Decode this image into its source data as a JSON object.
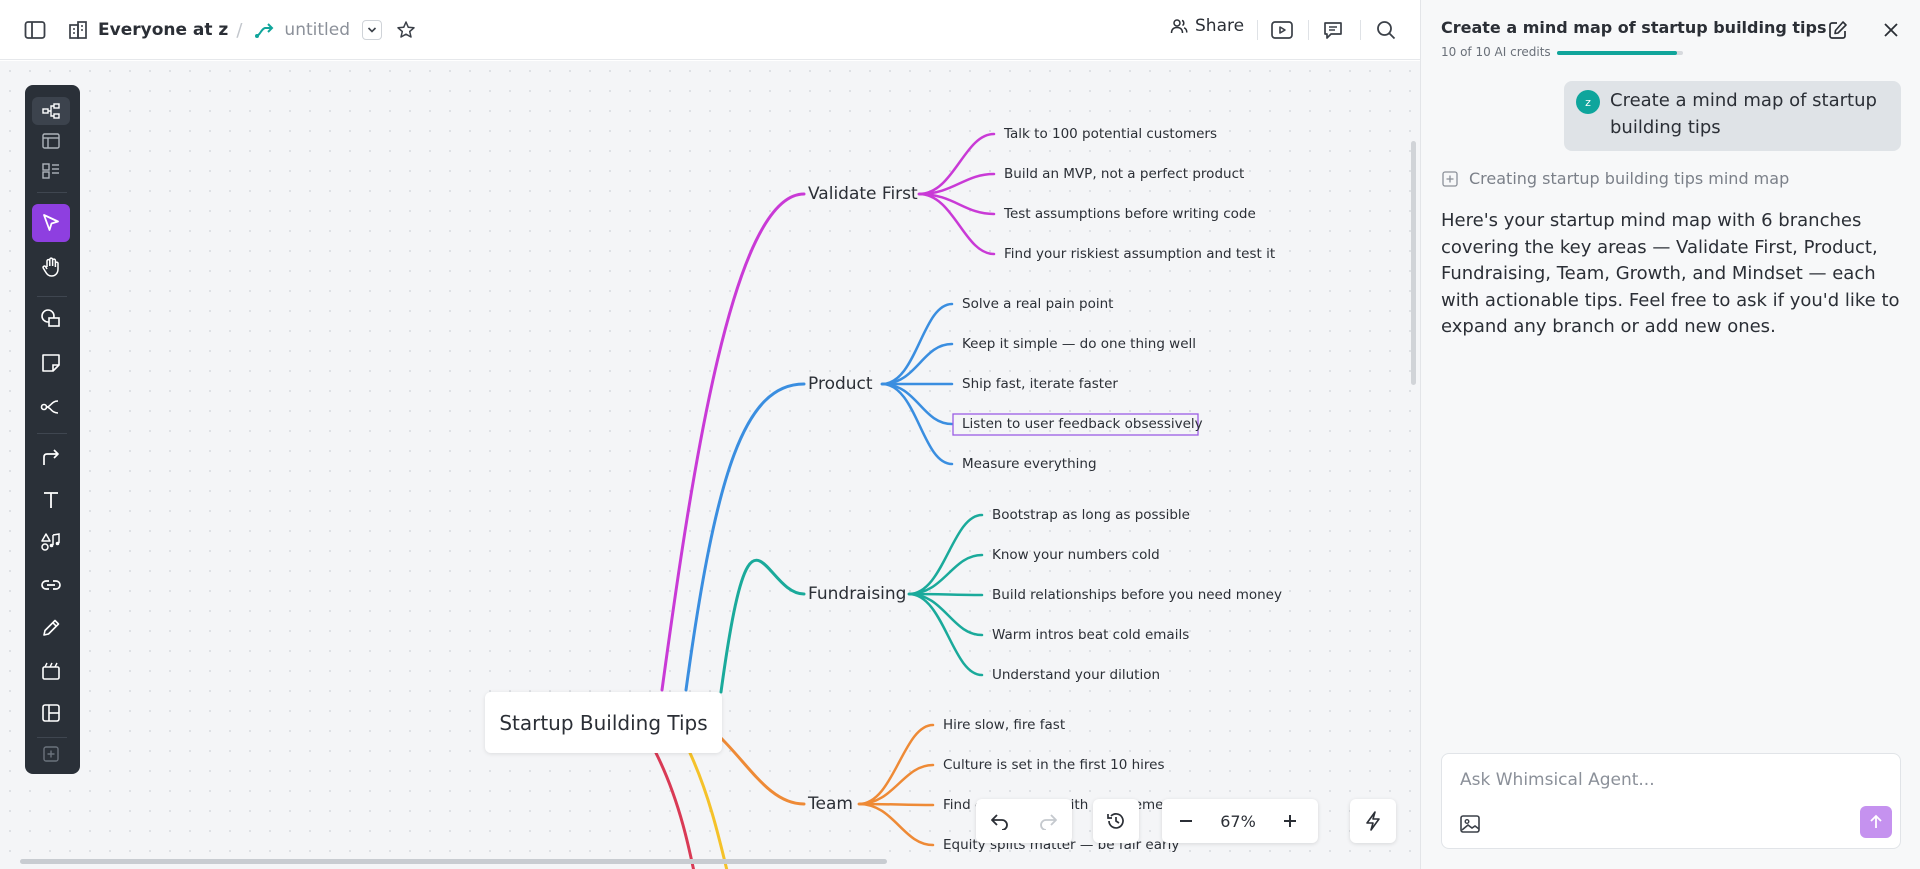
{
  "header": {
    "workspace": "Everyone at z",
    "separator": "/",
    "doc_title": "untitled",
    "share_label": "Share"
  },
  "mindmap": {
    "root": "Startup Building Tips",
    "branches": [
      {
        "label": "Validate First",
        "color": "#c93ad6",
        "children": [
          "Talk to 100 potential customers",
          "Build an MVP, not a perfect product",
          "Test assumptions before writing code",
          "Find your riskiest assumption and test it"
        ]
      },
      {
        "label": "Product",
        "color": "#3a8ee0",
        "children": [
          "Solve a real pain point",
          "Keep it simple — do one thing well",
          "Ship fast, iterate faster",
          "Listen to user feedback obsessively",
          "Measure everything"
        ]
      },
      {
        "label": "Fundraising",
        "color": "#1aaa9b",
        "children": [
          "Bootstrap as long as possible",
          "Know your numbers cold",
          "Build relationships before you need money",
          "Warm intros beat cold emails",
          "Understand your dilution"
        ]
      },
      {
        "label": "Team",
        "color": "#ee8a36",
        "children": [
          "Hire slow, fire fast",
          "Culture is set in the first 10 hires",
          "Find co-founders with complementary skills",
          "Equity splits matter — be fair early"
        ]
      }
    ],
    "extra_branch_colors": [
      "#d93a55",
      "#f5c22a"
    ],
    "selected_child": "Listen to user feedback obsessively",
    "selection_color": "#9b5de5"
  },
  "controls": {
    "zoom": "67%"
  },
  "panel": {
    "title": "Create a mind map of startup building tips",
    "credits": "10 of 10 AI credits",
    "credits_progress": 0.95,
    "user_initial": "z",
    "user_message": "Create a mind map of startup building tips",
    "status": "Creating startup building tips mind map",
    "assistant_message": "Here's your startup mind map with 6 branches covering the key areas — Validate First, Product, Fundraising, Team, Growth, and Mindset — each with actionable tips. Feel free to ask if you'd like to expand any branch or add new ones.",
    "input_placeholder": "Ask Whimsical Agent..."
  },
  "colors": {
    "accent": "#8e3fe0",
    "teal": "#10a59b",
    "toolbar_bg": "#2a3038"
  }
}
